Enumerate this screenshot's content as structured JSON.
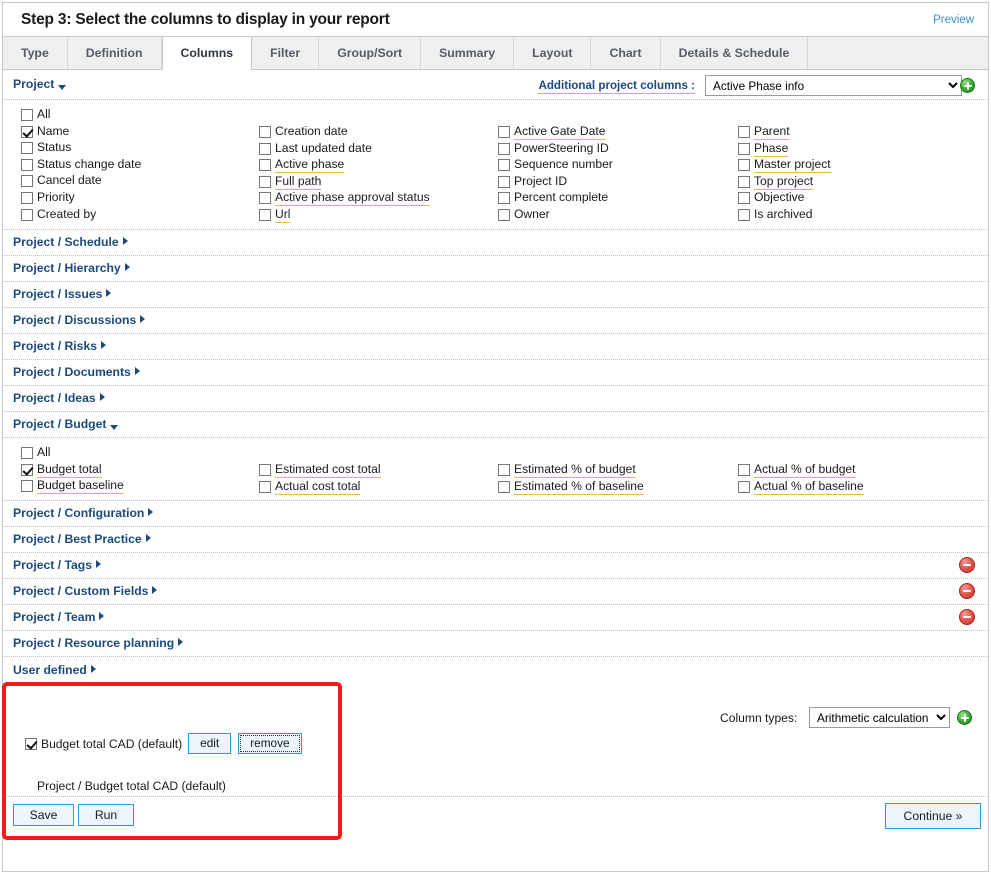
{
  "header": {
    "title": "Step 3: Select the columns to display in your report",
    "preview_label": "Preview"
  },
  "tabs": [
    {
      "label": "Type",
      "active": false
    },
    {
      "label": "Definition",
      "active": false
    },
    {
      "label": "Columns",
      "active": true
    },
    {
      "label": "Filter",
      "active": false
    },
    {
      "label": "Group/Sort",
      "active": false
    },
    {
      "label": "Summary",
      "active": false
    },
    {
      "label": "Layout",
      "active": false
    },
    {
      "label": "Chart",
      "active": false
    },
    {
      "label": "Details & Schedule",
      "active": false
    }
  ],
  "project_bar": {
    "group_label": "Project",
    "additional_label": "Additional project columns :",
    "additional_selected": "Active Phase info",
    "additional_options": [
      "Active Phase info"
    ],
    "add_icon": "plus-circle-icon"
  },
  "project_columns": {
    "col1": [
      {
        "label": "All",
        "checked": false,
        "tooltip": false
      },
      {
        "label": "Name",
        "checked": true,
        "tooltip": false
      },
      {
        "label": "Status",
        "checked": false,
        "tooltip": false
      },
      {
        "label": "Status change date",
        "checked": false,
        "tooltip": false
      },
      {
        "label": "Cancel date",
        "checked": false,
        "tooltip": false
      },
      {
        "label": "Priority",
        "checked": false,
        "tooltip": false
      },
      {
        "label": "Created by",
        "checked": false,
        "tooltip": false
      }
    ],
    "col2": [
      {
        "label": "Creation date",
        "checked": false,
        "tooltip": false
      },
      {
        "label": "Last updated date",
        "checked": false,
        "tooltip": false
      },
      {
        "label": "Active phase",
        "checked": false,
        "tooltip": true
      },
      {
        "label": "Full path",
        "checked": false,
        "tooltip": true
      },
      {
        "label": "Active phase approval status",
        "checked": false,
        "tooltip": true
      },
      {
        "label": "Url",
        "checked": false,
        "tooltip": true
      }
    ],
    "col3": [
      {
        "label": "Active Gate Date",
        "checked": false,
        "tooltip": true
      },
      {
        "label": "PowerSteering ID",
        "checked": false,
        "tooltip": false
      },
      {
        "label": "Sequence number",
        "checked": false,
        "tooltip": false
      },
      {
        "label": "Project ID",
        "checked": false,
        "tooltip": false
      },
      {
        "label": "Percent complete",
        "checked": false,
        "tooltip": false
      },
      {
        "label": "Owner",
        "checked": false,
        "tooltip": false
      }
    ],
    "col4": [
      {
        "label": "Parent",
        "checked": false,
        "tooltip": true
      },
      {
        "label": "Phase",
        "checked": false,
        "tooltip": true
      },
      {
        "label": "Master project",
        "checked": false,
        "tooltip": true
      },
      {
        "label": "Top project",
        "checked": false,
        "tooltip": true
      },
      {
        "label": "Objective",
        "checked": false,
        "tooltip": false
      },
      {
        "label": "Is archived",
        "checked": false,
        "tooltip": false
      }
    ]
  },
  "groups_upper": [
    {
      "label": "Project / Schedule",
      "expanded": false,
      "removable": false
    },
    {
      "label": "Project / Hierarchy",
      "expanded": false,
      "removable": false
    },
    {
      "label": "Project / Issues",
      "expanded": false,
      "removable": false
    },
    {
      "label": "Project / Discussions",
      "expanded": false,
      "removable": false
    },
    {
      "label": "Project / Risks",
      "expanded": false,
      "removable": false
    },
    {
      "label": "Project / Documents",
      "expanded": false,
      "removable": false
    },
    {
      "label": "Project / Ideas",
      "expanded": false,
      "removable": false
    }
  ],
  "budget_group": {
    "label": "Project / Budget",
    "expanded": true
  },
  "budget_columns": {
    "col1": [
      {
        "label": "All",
        "checked": false,
        "tooltip": false
      },
      {
        "label": "Budget total",
        "checked": true,
        "tooltip": true
      },
      {
        "label": "Budget baseline",
        "checked": false,
        "tooltip": true
      }
    ],
    "col2": [
      {
        "label": "Estimated cost total",
        "checked": false,
        "tooltip": true
      },
      {
        "label": "Actual cost total",
        "checked": false,
        "tooltip": true
      }
    ],
    "col3": [
      {
        "label": "Estimated % of budget",
        "checked": false,
        "tooltip": true
      },
      {
        "label": "Estimated % of baseline",
        "checked": false,
        "tooltip": true
      }
    ],
    "col4": [
      {
        "label": "Actual % of budget",
        "checked": false,
        "tooltip": true
      },
      {
        "label": "Actual % of baseline",
        "checked": false,
        "tooltip": true
      }
    ]
  },
  "groups_lower": [
    {
      "label": "Project / Configuration",
      "expanded": false,
      "removable": false
    },
    {
      "label": "Project / Best Practice",
      "expanded": false,
      "removable": false
    },
    {
      "label": "Project / Tags",
      "expanded": false,
      "removable": true
    },
    {
      "label": "Project / Custom Fields",
      "expanded": false,
      "removable": true
    },
    {
      "label": "Project / Team",
      "expanded": false,
      "removable": true
    },
    {
      "label": "Project / Resource planning",
      "expanded": false,
      "removable": false
    }
  ],
  "user_defined": {
    "label": "User defined",
    "item_label": "Budget total CAD (default)",
    "item_checked": true,
    "edit_label": "edit",
    "remove_label": "remove",
    "sub_label": "Project / Budget total CAD (default)",
    "coltypes_label": "Column types:",
    "coltypes_selected": "Arithmetic calculation",
    "coltypes_options": [
      "Arithmetic calculation"
    ],
    "add_icon": "plus-circle-icon"
  },
  "footer": {
    "save_label": "Save",
    "run_label": "Run",
    "continue_label": "Continue »"
  },
  "annotation": {
    "type": "red-rectangle-highlight",
    "color": "#ee1c1c"
  },
  "icons": {
    "remove_group": "minus-circle-icon",
    "collapsed": "chevron-right-icon",
    "expanded": "chevron-down-icon"
  }
}
